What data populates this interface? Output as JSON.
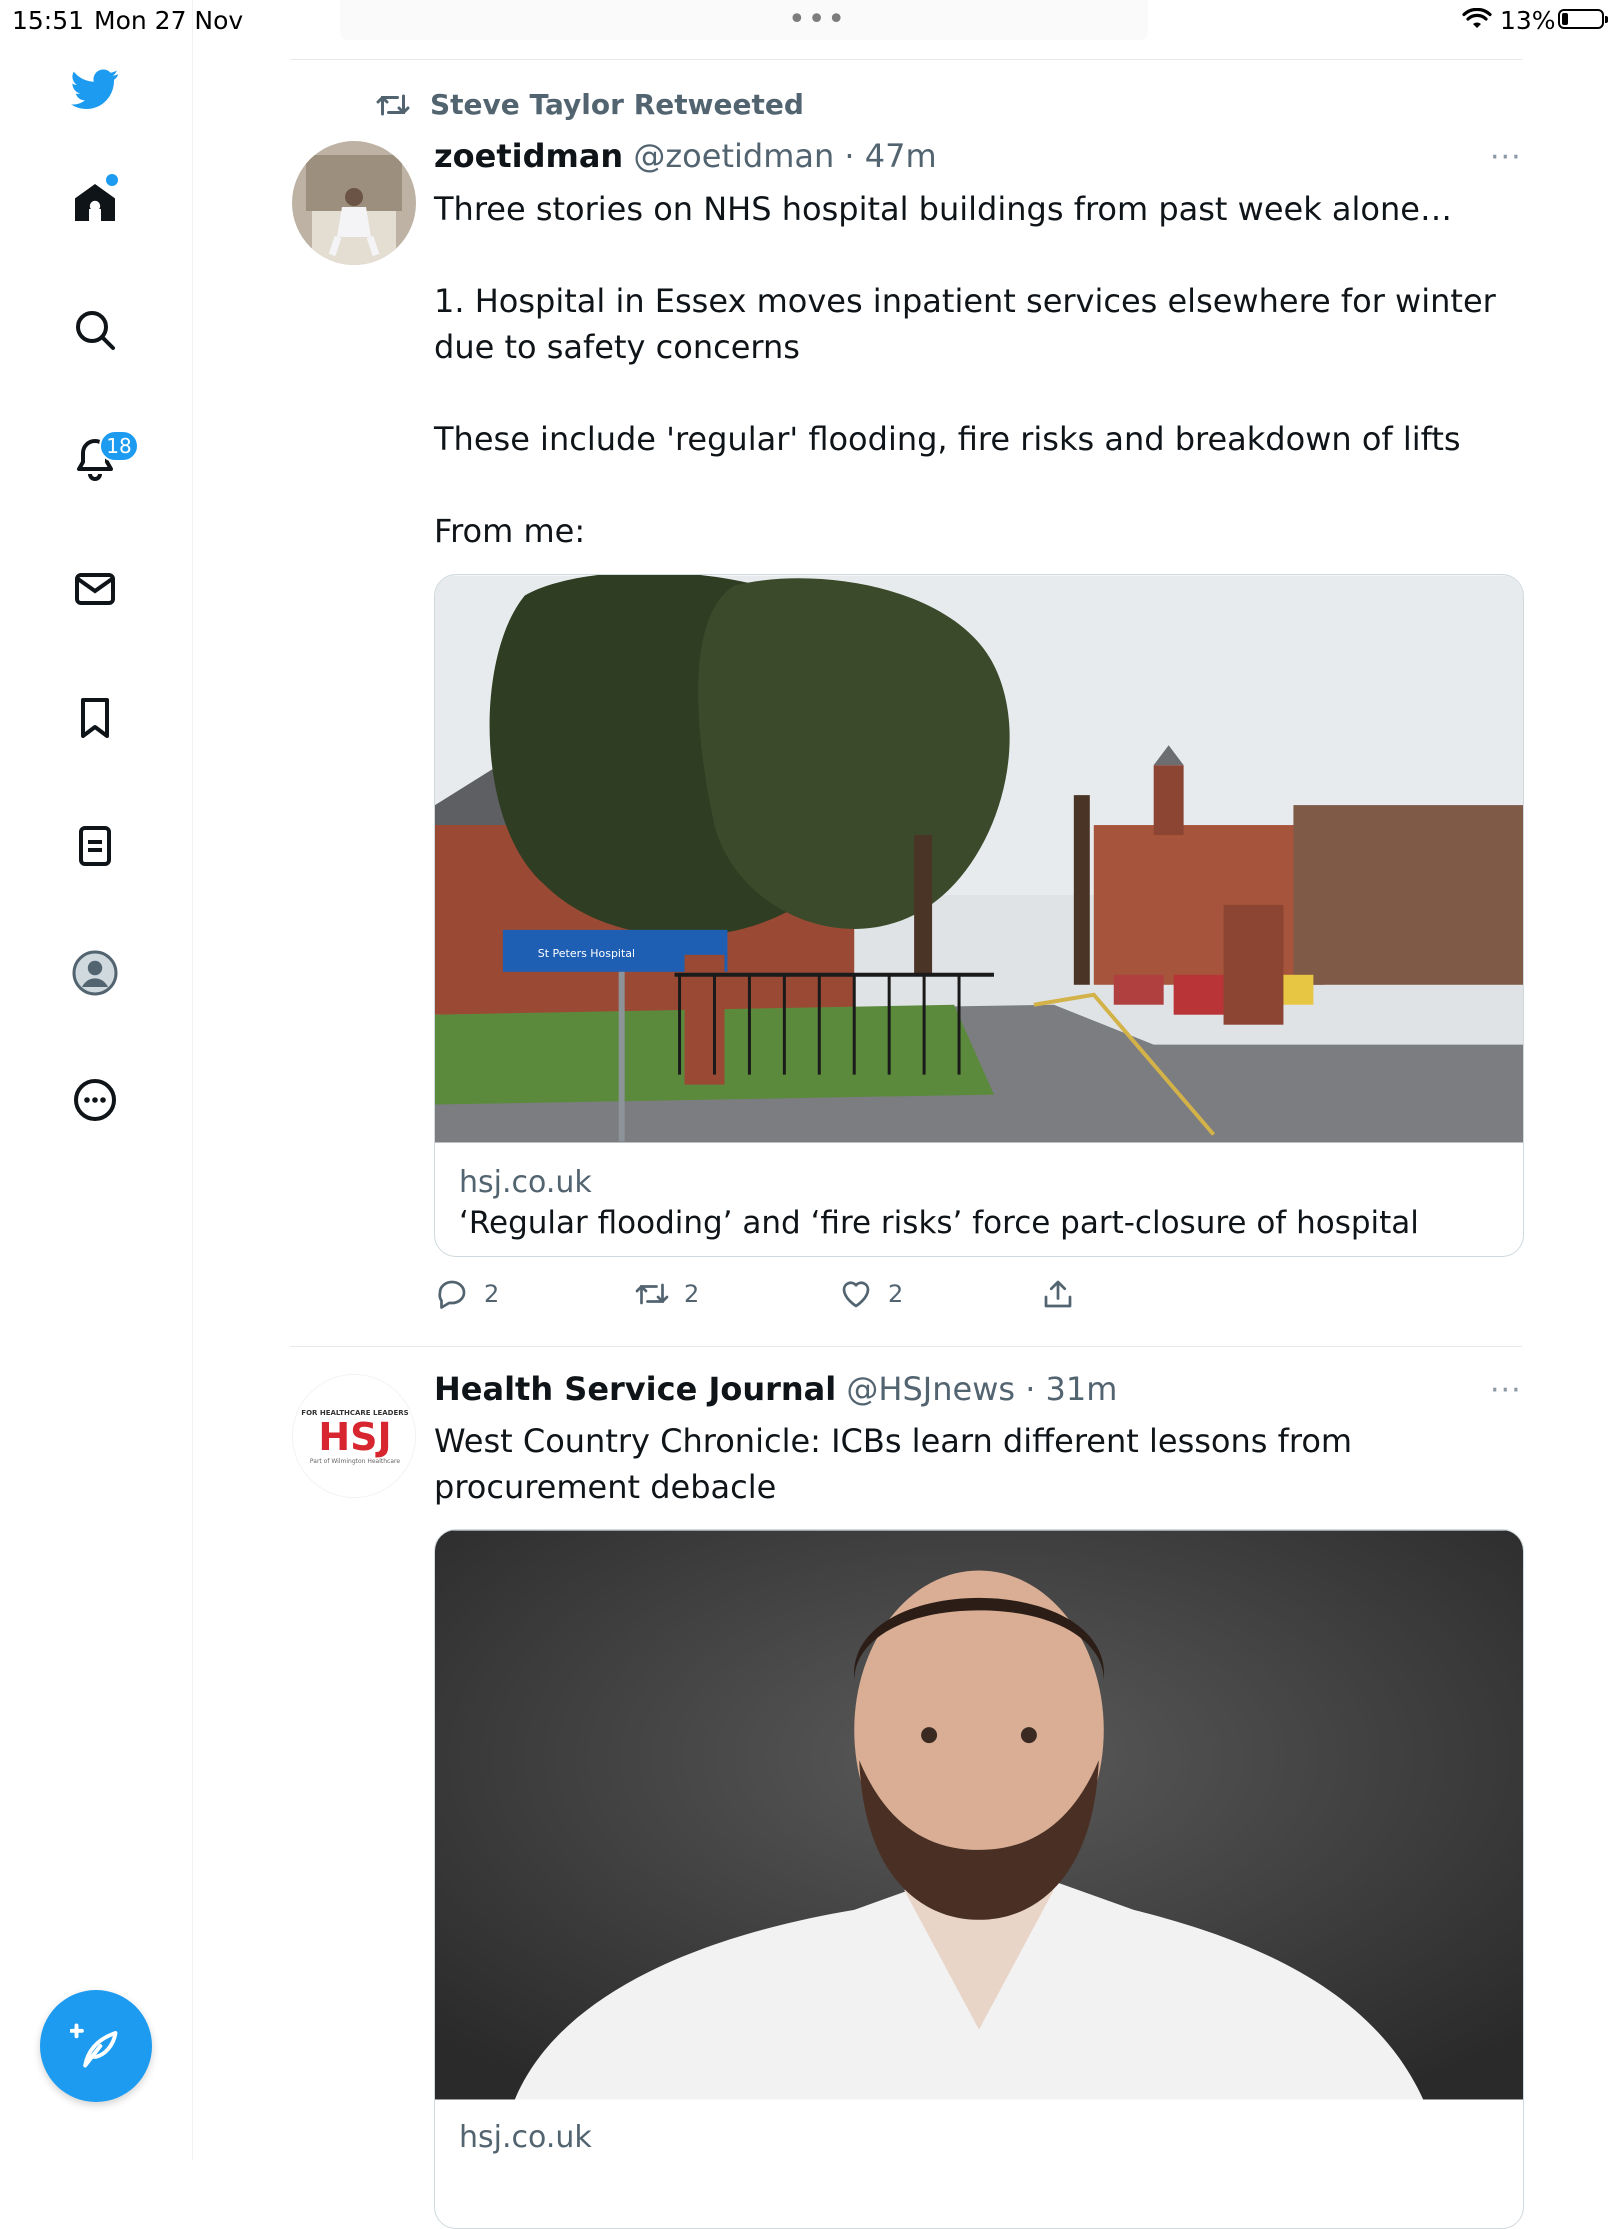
{
  "status_bar": {
    "time": "15:51",
    "date": "Mon 27 Nov",
    "battery": "13%"
  },
  "sidebar": {
    "notifications_count": "18",
    "items": [
      "home-icon",
      "search-icon",
      "bell-icon",
      "mail-icon",
      "bookmark-icon",
      "list-icon",
      "profile-icon",
      "more-icon"
    ]
  },
  "tweets": [
    {
      "social_context": "Steve Taylor Retweeted",
      "name": "zoetidman",
      "handle": "@zoetidman",
      "time": "· 47m",
      "more": "···",
      "text": [
        "Three stories on NHS hospital buildings from past week alone…",
        "",
        "1. Hospital in Essex moves inpatient services elsewhere for winter due to safety concerns",
        "",
        "These include 'regular' flooding, fire risks and breakdown of lifts",
        "",
        "From me:"
      ],
      "card": {
        "domain": "hsj.co.uk",
        "title": "‘Regular flooding’ and ‘fire risks’ force part-closure of hospital",
        "sign_text": "St Peters Hospital"
      },
      "actions": {
        "replies": "2",
        "retweets": "2",
        "likes": "2"
      }
    },
    {
      "name": "Health Service Journal",
      "handle": "@HSJnews",
      "time": "· 31m",
      "more": "···",
      "avatar_logo": "HSJ",
      "avatar_top": "FOR HEALTHCARE LEADERS",
      "avatar_bottom": "Part of Wilmington Healthcare",
      "text": [
        "West Country Chronicle: ICBs learn different lessons from procurement debacle"
      ],
      "card": {
        "domain": "hsj.co.uk"
      }
    }
  ],
  "colors": {
    "accent": "#1d9bf0",
    "text": "#0f1419",
    "secondary": "#536471",
    "hsj_red": "#d7262f"
  }
}
